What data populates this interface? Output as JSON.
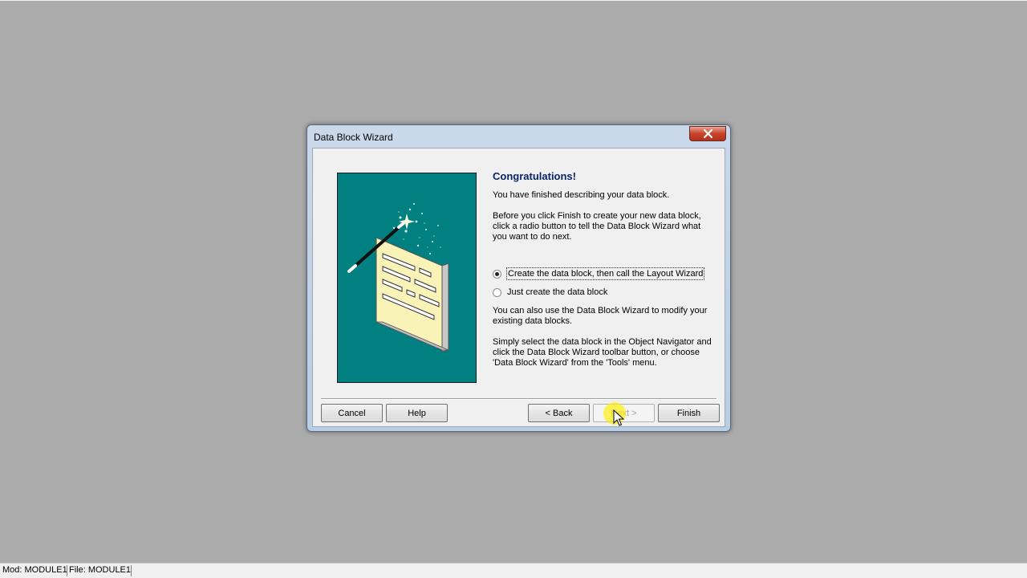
{
  "dialog": {
    "title": "Data Block Wizard",
    "heading": "Congratulations!",
    "finished_text": "You have finished describing your data block.",
    "instruction_text": "Before you click Finish to create your new data block,\nclick a radio button to tell the Data Block Wizard what\nyou want to do next.",
    "options": [
      {
        "label": "Create the data block, then call the Layout Wizard",
        "checked": true
      },
      {
        "label": "Just create the data block",
        "checked": false
      }
    ],
    "modify_text": "You can also use the Data Block Wizard to modify your\nexisting data blocks.",
    "select_text": "Simply select the data block in the Object Navigator and\nclick the Data Block Wizard toolbar button, or choose\n'Data Block Wizard' from the 'Tools' menu.",
    "buttons": {
      "cancel": "Cancel",
      "help": "Help",
      "back": "< Back",
      "next": "Next >",
      "finish": "Finish"
    }
  },
  "statusbar": {
    "module": "Mod: MODULE1",
    "file": "File: MODULE1"
  },
  "colors": {
    "desktop": "#ababab",
    "illustration_bg": "#008080",
    "heading": "#0a246a"
  }
}
